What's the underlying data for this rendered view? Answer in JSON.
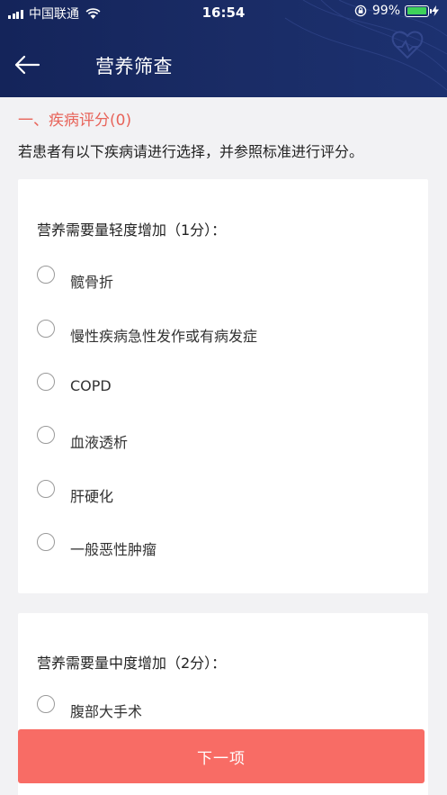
{
  "status_bar": {
    "carrier": "中国联通",
    "time": "16:54",
    "battery": "99%",
    "battery_level": 0.99
  },
  "nav": {
    "title": "营养筛查"
  },
  "section": {
    "title": "一、疾病评分(0)",
    "instruction": "若患者有以下疾病请进行选择，并参照标准进行评分。"
  },
  "groups": [
    {
      "heading": "营养需要量轻度增加（1分）：",
      "options": [
        "髋骨折",
        "慢性疾病急性发作或有病发症",
        "COPD",
        "血液透析",
        "肝硬化",
        "一般恶性肿瘤"
      ]
    },
    {
      "heading": "营养需要量中度增加（2分）：",
      "options": [
        "腹部大手术"
      ]
    }
  ],
  "footer": {
    "next_label": "下一项"
  },
  "colors": {
    "header_bg": "#1a2c66",
    "accent": "#e8645a",
    "button": "#f86c65",
    "battery": "#3ed15a"
  },
  "icons": [
    "signal-icon",
    "wifi-icon",
    "orientation-lock-icon",
    "battery-icon",
    "charging-icon",
    "back-arrow-icon",
    "heart-pulse-icon"
  ]
}
